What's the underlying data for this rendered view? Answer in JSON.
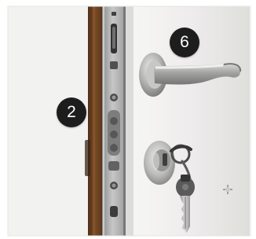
{
  "callouts": {
    "frame_marker": "2",
    "handle_marker": "6"
  },
  "colors": {
    "marker_bg": "#1d1d1d",
    "marker_text": "#ffffff",
    "door_panel": "#e7e7e4",
    "wood_frame": "#6e4524",
    "metal": "#a8a9a8"
  },
  "icons": {
    "door": "door-panel-photo",
    "handle": "lever-handle-icon",
    "lock": "lock-cylinder-icon",
    "key": "key-icon"
  }
}
